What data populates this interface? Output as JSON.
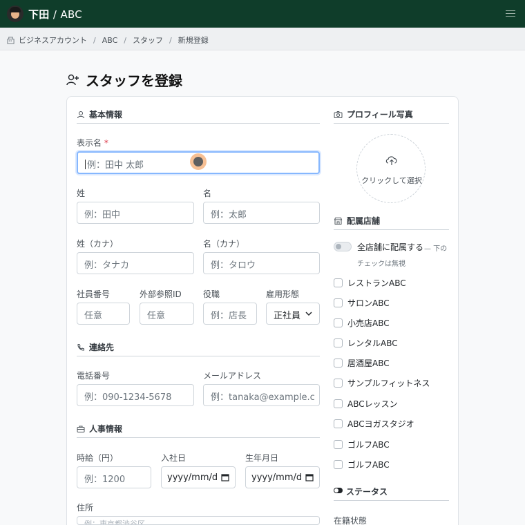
{
  "header": {
    "user_name": "下田",
    "separator": "/",
    "org": "ABC"
  },
  "breadcrumb": [
    "ビジネスアカウント",
    "ABC",
    "スタッフ",
    "新規登録"
  ],
  "page_title": "スタッフを登録",
  "sections": {
    "basic": "基本情報",
    "contact": "連絡先",
    "hr": "人事情報",
    "photo": "プロフィール写真",
    "stores": "配属店舗",
    "status": "ステータス"
  },
  "fields": {
    "display_name": {
      "label": "表示名",
      "required_mark": "*",
      "placeholder": "例：田中 太郎"
    },
    "last_name": {
      "label": "姓",
      "placeholder": "例：田中"
    },
    "first_name": {
      "label": "名",
      "placeholder": "例：太郎"
    },
    "last_name_kana": {
      "label": "姓（カナ）",
      "placeholder": "例：タナカ"
    },
    "first_name_kana": {
      "label": "名（カナ）",
      "placeholder": "例：タロウ"
    },
    "employee_no": {
      "label": "社員番号",
      "placeholder": "任意"
    },
    "external_id": {
      "label": "外部参照ID",
      "placeholder": "任意"
    },
    "position": {
      "label": "役職",
      "placeholder": "例：店長"
    },
    "employment_type": {
      "label": "雇用形態",
      "value": "正社員"
    },
    "phone": {
      "label": "電話番号",
      "placeholder": "例：090-1234-5678"
    },
    "email": {
      "label": "メールアドレス",
      "placeholder": "例：tanaka@example.c"
    },
    "hourly_wage": {
      "label": "時給（円）",
      "placeholder": "例：1200"
    },
    "hire_date": {
      "label": "入社日",
      "value": "yyyy/mm/d"
    },
    "birth_date": {
      "label": "生年月日",
      "value": "yyyy/mm/d"
    },
    "address": {
      "label": "住所",
      "placeholder": "例：東京都渋谷区..."
    }
  },
  "photo": {
    "label": "クリックして選択"
  },
  "stores": {
    "all_label": "全店舗に配属する",
    "all_note_1": "— 下の",
    "all_note_2": "チェックは無視",
    "items": [
      "レストランABC",
      "サロンABC",
      "小売店ABC",
      "レンタルABC",
      "居酒屋ABC",
      "サンプルフィットネス",
      "ABCレッスン",
      "ABCヨガスタジオ",
      "ゴルフABC",
      "ゴルフABC"
    ]
  },
  "status": {
    "label": "在籍状態"
  }
}
